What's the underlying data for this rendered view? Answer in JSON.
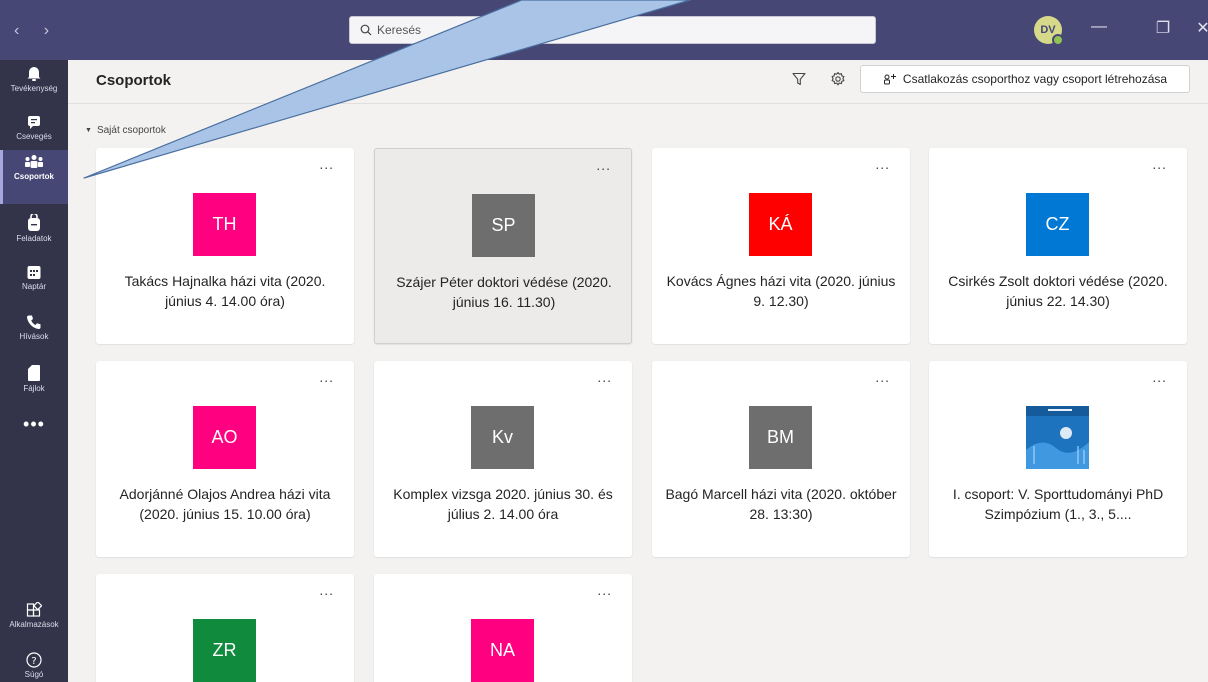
{
  "titlebar": {
    "search_placeholder": "Keresés",
    "user_initials": "DV"
  },
  "rail": {
    "items": [
      {
        "label": "Tevékenység",
        "icon": "bell-icon"
      },
      {
        "label": "Csevegés",
        "icon": "chat-icon"
      },
      {
        "label": "Csoportok",
        "icon": "teams-icon"
      },
      {
        "label": "Feladatok",
        "icon": "backpack-icon"
      },
      {
        "label": "Naptár",
        "icon": "calendar-icon"
      },
      {
        "label": "Hívások",
        "icon": "phone-icon"
      },
      {
        "label": "Fájlok",
        "icon": "file-icon"
      },
      {
        "label": "Alkalmazások",
        "icon": "apps-icon"
      },
      {
        "label": "Súgó",
        "icon": "help-icon"
      }
    ],
    "more": "•••"
  },
  "header": {
    "title": "Csoportok",
    "join_label": "Csatlakozás csoporthoz vagy csoport létrehozása"
  },
  "section": {
    "label": "Saját csoportok"
  },
  "teams": [
    {
      "initials": "TH",
      "color": "#ff0080",
      "name": "Takács Hajnalka házi vita (2020. június 4. 14.00 óra)"
    },
    {
      "initials": "SP",
      "color": "#6e6e6e",
      "name": "Szájer Péter doktori védése (2020. június 16. 11.30)"
    },
    {
      "initials": "KÁ",
      "color": "#ff0000",
      "name": "Kovács Ágnes házi vita (2020. június 9. 12.30)"
    },
    {
      "initials": "CZ",
      "color": "#0078d4",
      "name": "Csirkés Zsolt doktori védése (2020. június 22. 14.30)"
    },
    {
      "initials": "AO",
      "color": "#ff0080",
      "name": "Adorjánné Olajos Andrea házi vita (2020. június 15. 10.00 óra)"
    },
    {
      "initials": "Kv",
      "color": "#6e6e6e",
      "name": "Komplex vizsga 2020. június 30. és július 2. 14.00 óra"
    },
    {
      "initials": "BM",
      "color": "#6e6e6e",
      "name": "Bagó Marcell házi vita (2020. október 28. 13:30)"
    },
    {
      "initials": "",
      "color": "#1e73be",
      "name": "I. csoport: V. Sporttudományi PhD Szimpózium (1., 3., 5...."
    },
    {
      "initials": "ZR",
      "color": "#108a3c",
      "name": ""
    },
    {
      "initials": "NA",
      "color": "#ff0080",
      "name": ""
    }
  ],
  "card_menu": "..."
}
